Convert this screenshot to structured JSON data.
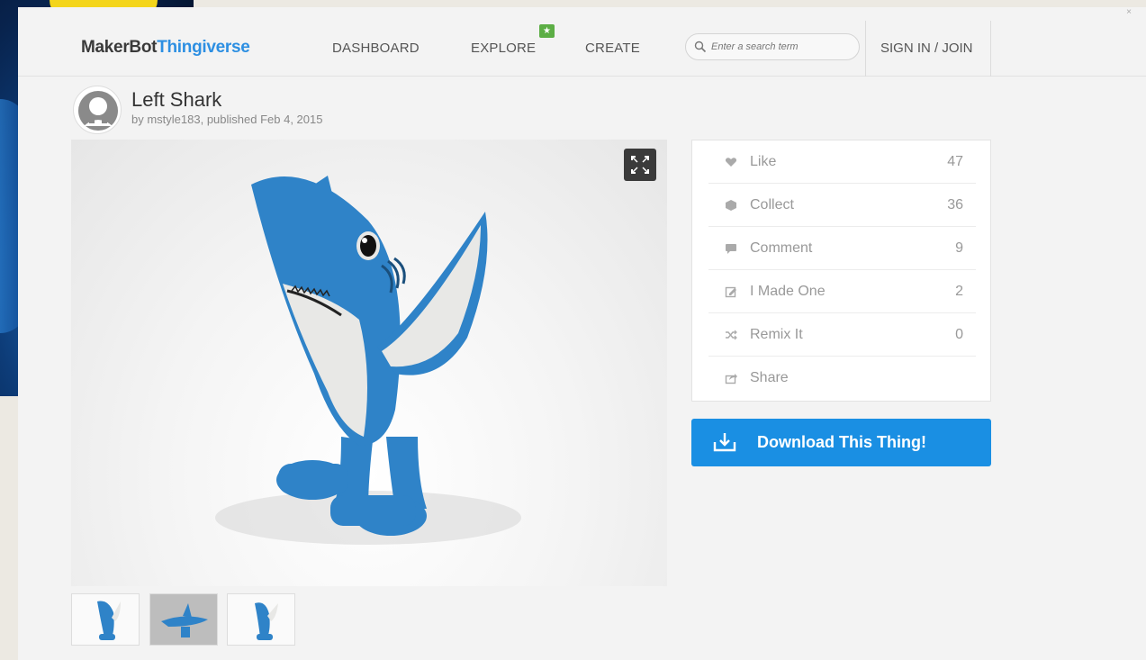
{
  "window": {
    "close_label": "×"
  },
  "header": {
    "logo_part1": "MakerBot",
    "logo_part2": "Thingiverse",
    "nav": {
      "dashboard": "DASHBOARD",
      "explore": "EXPLORE",
      "create": "CREATE"
    },
    "explore_badge": "★",
    "search": {
      "placeholder": "Enter a search term",
      "value": ""
    },
    "signin": "SIGN IN / JOIN"
  },
  "thing": {
    "title": "Left Shark",
    "byline": "by mstyle183, published Feb 4, 2015"
  },
  "stats": [
    {
      "label": "Like",
      "count": "47",
      "icon": "heart-icon"
    },
    {
      "label": "Collect",
      "count": "36",
      "icon": "collect-icon"
    },
    {
      "label": "Comment",
      "count": "9",
      "icon": "comment-icon"
    },
    {
      "label": "I Made One",
      "count": "2",
      "icon": "made-one-icon"
    },
    {
      "label": "Remix It",
      "count": "0",
      "icon": "remix-icon"
    },
    {
      "label": "Share",
      "count": "",
      "icon": "share-icon"
    }
  ],
  "download": {
    "label": "Download This Thing!",
    "color": "#1a8fe3"
  },
  "colors": {
    "accent": "#2d8fe2",
    "badge": "#5cae45",
    "shark_blue": "#2f83c8"
  }
}
